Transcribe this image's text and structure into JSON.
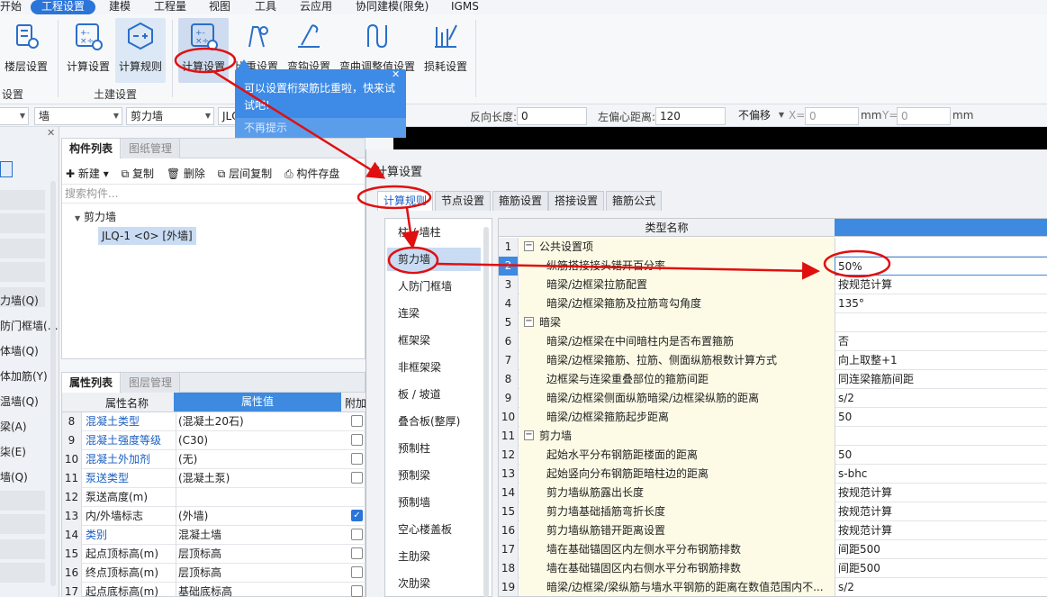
{
  "menu": [
    "开始",
    "工程设置",
    "建模",
    "工程量",
    "视图",
    "工具",
    "云应用",
    "协同建模(限免)",
    "IGMS"
  ],
  "menu_active": "工程设置",
  "ribbon": {
    "buttons": [
      "楼层设置",
      "计算设置",
      "计算规则",
      "计算设置",
      "比重设置",
      "弯钩设置",
      "弯曲调整值设置",
      "损耗设置"
    ],
    "groups": [
      "设置",
      "土建设置"
    ]
  },
  "tooltip": {
    "text": "可以设置桁架筋比重啦，快来试试吧!",
    "dismiss": "不再提示"
  },
  "toolbar": {
    "combo1": "墙",
    "combo2": "剪力墙",
    "combo3": "JLQ",
    "reverse_label": "反向长度:",
    "reverse_value": "0",
    "offset_label": "左偏心距离:",
    "offset_value": "120",
    "no_offset": "不偏移",
    "x_label": "X=",
    "x_value": "0",
    "x_unit": "mm",
    "y_label": "Y=",
    "y_value": "0",
    "y_unit": "mm"
  },
  "leftnarrow": [
    "力墙(Q)",
    "防门框墙(…",
    "体墙(Q)",
    "体加筋(Y)",
    "温墙(Q)",
    "梁(A)",
    "柒(E)",
    "墙(Q)"
  ],
  "complist": {
    "tab_on": "构件列表",
    "tab_off": "图纸管理",
    "actions": [
      "新建",
      "复制",
      "删除",
      "层间复制",
      "构件存盘"
    ],
    "search_placeholder": "搜索构件...",
    "tree_root": "剪力墙",
    "tree_item": "JLQ-1 <0> [外墙]"
  },
  "proplist": {
    "tab_on": "属性列表",
    "tab_off": "图层管理",
    "headers": [
      "属性名称",
      "属性值",
      "附加"
    ],
    "rows": [
      {
        "n": "8",
        "name": "混凝土类型",
        "value": "(混凝土20石)",
        "blue": true,
        "check": false
      },
      {
        "n": "9",
        "name": "混凝土强度等级",
        "value": "(C30)",
        "blue": true,
        "check": false
      },
      {
        "n": "10",
        "name": "混凝土外加剂",
        "value": "(无)",
        "blue": true,
        "check": false
      },
      {
        "n": "11",
        "name": "泵送类型",
        "value": "(混凝土泵)",
        "blue": true,
        "check": false
      },
      {
        "n": "12",
        "name": "泵送高度(m)",
        "value": "",
        "blue": false,
        "check": null
      },
      {
        "n": "13",
        "name": "内/外墙标志",
        "value": "(外墙)",
        "blue": false,
        "check": true
      },
      {
        "n": "14",
        "name": "类别",
        "value": "混凝土墙",
        "blue": true,
        "check": false
      },
      {
        "n": "15",
        "name": "起点顶标高(m)",
        "value": "层顶标高",
        "blue": false,
        "check": false
      },
      {
        "n": "16",
        "name": "终点顶标高(m)",
        "value": "层顶标高",
        "blue": false,
        "check": false
      },
      {
        "n": "17",
        "name": "起点底标高(m)",
        "value": "基础底标高",
        "blue": false,
        "check": false
      }
    ]
  },
  "dialog": {
    "title": "计算设置",
    "tabs": [
      "计算规则",
      "节点设置",
      "箍筋设置",
      "搭接设置",
      "箍筋公式"
    ],
    "categories": [
      "柱 / 墙柱",
      "剪力墙",
      "人防门框墙",
      "连梁",
      "框架梁",
      "非框架梁",
      "板 / 坡道",
      "叠合板(整厚)",
      "预制柱",
      "预制梁",
      "预制墙",
      "空心楼盖板",
      "主肋梁",
      "次肋梁"
    ],
    "grid_header": "类型名称",
    "rows": [
      {
        "n": "1",
        "name": "公共设置项",
        "value": "",
        "group": true
      },
      {
        "n": "2",
        "name": "纵筋搭接接头错开百分率",
        "value": "50%",
        "group": false,
        "sel": true
      },
      {
        "n": "3",
        "name": "暗梁/边框梁拉筋配置",
        "value": "按规范计算",
        "group": false
      },
      {
        "n": "4",
        "name": "暗梁/边框梁箍筋及拉筋弯勾角度",
        "value": "135°",
        "group": false
      },
      {
        "n": "5",
        "name": "暗梁",
        "value": "",
        "group": true
      },
      {
        "n": "6",
        "name": "暗梁/边框梁在中间暗柱内是否布置箍筋",
        "value": "否",
        "group": false
      },
      {
        "n": "7",
        "name": "暗梁/边框梁箍筋、拉筋、侧面纵筋根数计算方式",
        "value": "向上取整+1",
        "group": false
      },
      {
        "n": "8",
        "name": "边框梁与连梁重叠部位的箍筋间距",
        "value": "同连梁箍筋间距",
        "group": false
      },
      {
        "n": "9",
        "name": "暗梁/边框梁侧面纵筋暗梁/边框梁纵筋的距离",
        "value": "s/2",
        "group": false
      },
      {
        "n": "10",
        "name": "暗梁/边框梁箍筋起步距离",
        "value": "50",
        "group": false
      },
      {
        "n": "11",
        "name": "剪力墙",
        "value": "",
        "group": true
      },
      {
        "n": "12",
        "name": "起始水平分布钢筋距楼面的距离",
        "value": "50",
        "group": false
      },
      {
        "n": "13",
        "name": "起始竖向分布钢筋距暗柱边的距离",
        "value": "s-bhc",
        "group": false
      },
      {
        "n": "14",
        "name": "剪力墙纵筋露出长度",
        "value": "按规范计算",
        "group": false
      },
      {
        "n": "15",
        "name": "剪力墙基础插筋弯折长度",
        "value": "按规范计算",
        "group": false
      },
      {
        "n": "16",
        "name": "剪力墙纵筋错开距离设置",
        "value": "按规范计算",
        "group": false
      },
      {
        "n": "17",
        "name": "墙在基础锚固区内左侧水平分布钢筋排数",
        "value": "间距500",
        "group": false
      },
      {
        "n": "18",
        "name": "墙在基础锚固区内右侧水平分布钢筋排数",
        "value": "间距500",
        "group": false
      },
      {
        "n": "19",
        "name": "暗梁/边框梁/梁纵筋与墙水平钢筋的距离在数值范围内不...",
        "value": "s/2",
        "group": false
      }
    ]
  },
  "colors": {
    "accent": "#2b74d9",
    "annotation": "#e01010",
    "tooltip": "#3d8be6",
    "row_name_bg": "#fdfbe6"
  }
}
